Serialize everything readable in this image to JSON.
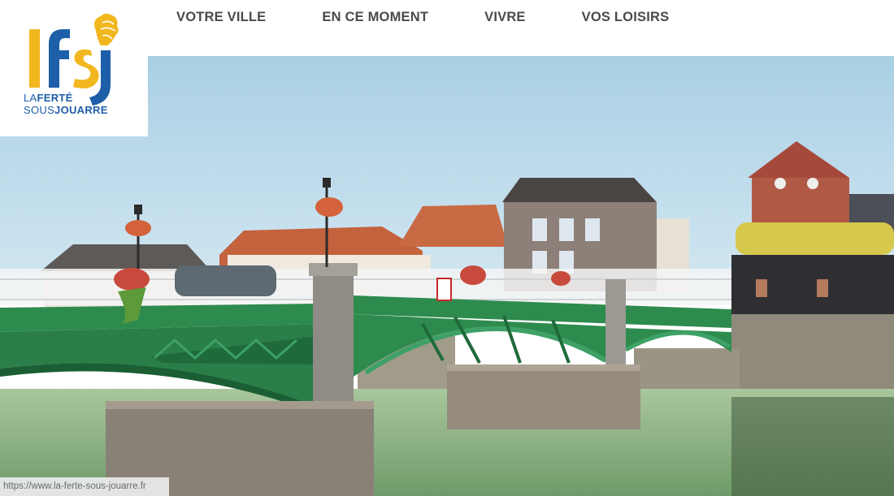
{
  "nav": {
    "items": [
      {
        "label": "VOTRE VILLE"
      },
      {
        "label": "EN CE MOMENT"
      },
      {
        "label": "VIVRE"
      },
      {
        "label": "VOS LOISIRS"
      }
    ]
  },
  "logo": {
    "monogram": "lfsj",
    "line1_a": "LA",
    "line1_b": "FERTÉ",
    "line2_a": "SOUS",
    "line2_b": "JOUARRE"
  },
  "status_url": "https://www.la-ferte-sous-jouarre.fr",
  "colors": {
    "nav_text": "#4a4a4a",
    "logo_blue": "#1d5fa8",
    "logo_yellow": "#f2b71f",
    "bridge_green": "#2e8b4e",
    "sky": "#b9d9ea",
    "water": "#8fb98a"
  }
}
